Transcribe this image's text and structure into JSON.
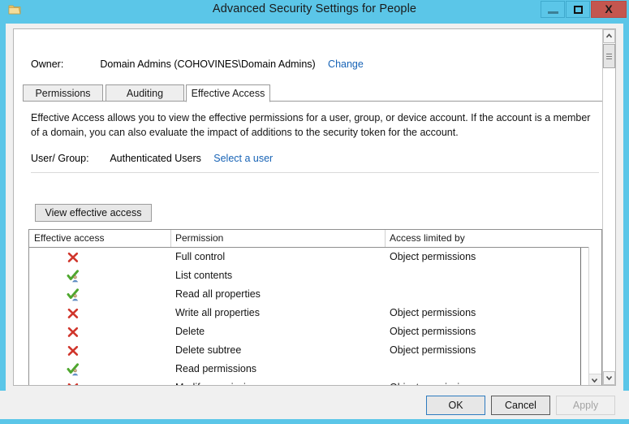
{
  "window": {
    "title": "Advanced Security Settings for People",
    "folder_icon": "folder-icon",
    "minimize_label": "",
    "maximize_label": "",
    "close_label": "X",
    "accent_color": "#5bc6e8",
    "close_color": "#c4564f"
  },
  "owner": {
    "label": "Owner:",
    "value": "Domain Admins (COHOVINES\\Domain Admins)",
    "change_link": "Change"
  },
  "tabs": [
    {
      "label": "Permissions",
      "active": false
    },
    {
      "label": "Auditing",
      "active": false
    },
    {
      "label": "Effective Access",
      "active": true
    }
  ],
  "description": "Effective Access allows you to view the effective permissions for a user, group, or device account. If the account is a member of a domain, you can also evaluate the impact of additions to the security token for the account.",
  "user_group": {
    "label": "User/ Group:",
    "value": "Authenticated Users",
    "select_link": "Select a user"
  },
  "view_button": {
    "label": "View effective access"
  },
  "table": {
    "columns": [
      "Effective access",
      "Permission",
      "Access limited by"
    ],
    "rows": [
      {
        "access": "denied",
        "permission": "Full control",
        "limited_by": "Object permissions"
      },
      {
        "access": "granted",
        "permission": "List contents",
        "limited_by": ""
      },
      {
        "access": "granted",
        "permission": "Read all properties",
        "limited_by": ""
      },
      {
        "access": "denied",
        "permission": "Write all properties",
        "limited_by": "Object permissions"
      },
      {
        "access": "denied",
        "permission": "Delete",
        "limited_by": "Object permissions"
      },
      {
        "access": "denied",
        "permission": "Delete subtree",
        "limited_by": "Object permissions"
      },
      {
        "access": "granted",
        "permission": "Read permissions",
        "limited_by": ""
      },
      {
        "access": "denied",
        "permission": "Modify permissions",
        "limited_by": "Object permissions"
      }
    ],
    "icon_denied": "red-x-icon",
    "icon_granted": "green-check-user-icon",
    "denied_color": "#d0352b",
    "granted_color": "#4ea72e"
  },
  "footer": {
    "ok": "OK",
    "cancel": "Cancel",
    "apply": "Apply",
    "apply_enabled": false
  }
}
